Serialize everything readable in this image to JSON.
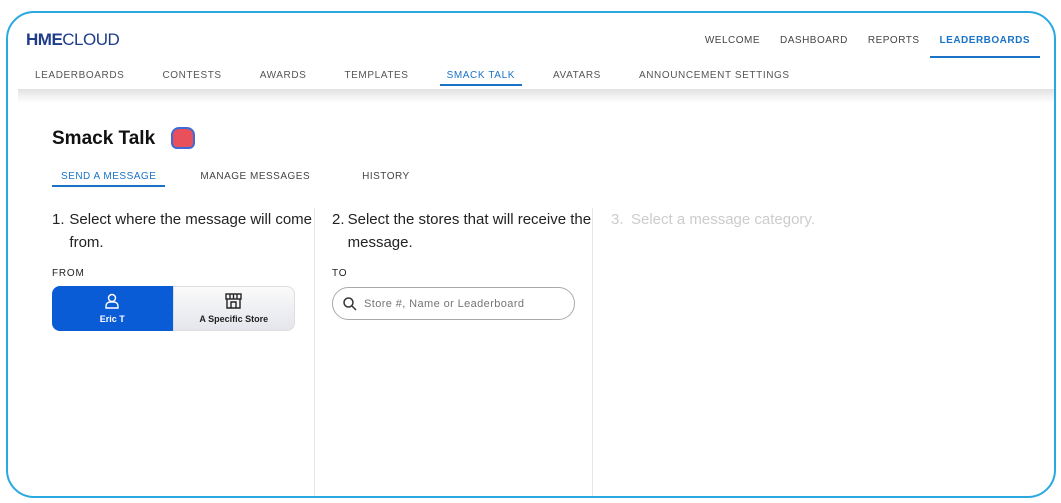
{
  "logo": {
    "bold": "HME",
    "light": "CLOUD"
  },
  "topnav": [
    "WELCOME",
    "DASHBOARD",
    "REPORTS",
    "LEADERBOARDS"
  ],
  "subnav": [
    "LEADERBOARDS",
    "CONTESTS",
    "AWARDS",
    "TEMPLATES",
    "SMACK TALK",
    "AVATARS",
    "ANNOUNCEMENT SETTINGS"
  ],
  "page_title": "Smack Talk",
  "tabs": [
    "SEND A MESSAGE",
    "MANAGE MESSAGES",
    "HISTORY"
  ],
  "step1": {
    "num": "1.",
    "text": "Select where the message will come from.",
    "label": "FROM",
    "options": [
      "Eric T",
      "A Specific Store"
    ]
  },
  "step2": {
    "num": "2.",
    "text": "Select the stores that will receive the message.",
    "label": "TO",
    "placeholder": "Store #, Name or Leaderboard"
  },
  "step3": {
    "num": "3.",
    "text": "Select a message category."
  }
}
